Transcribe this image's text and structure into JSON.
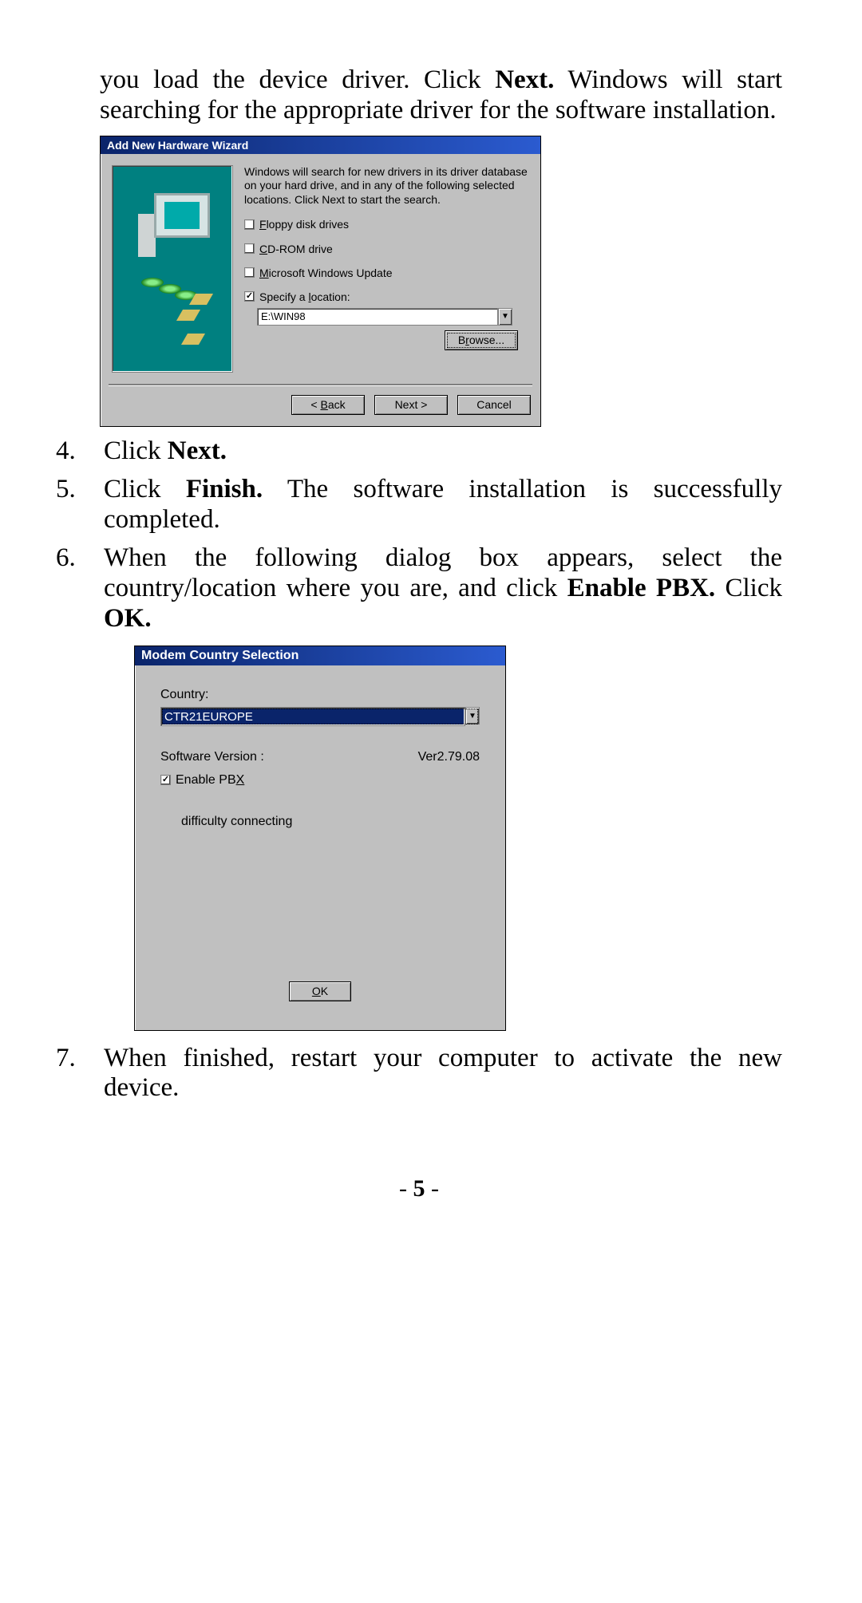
{
  "para1": {
    "pre": "you load the device driver. Click ",
    "bold1": "Next.",
    "post": " Windows will start searching for the appropriate driver for the software installation."
  },
  "wizard": {
    "title": "Add New Hardware Wizard",
    "intro": "Windows will search for new drivers in its driver database on your hard drive, and in any of the following selected locations. Click Next to start the search.",
    "floppy_u": "F",
    "floppy_rest": "loppy disk drives",
    "cdrom_u": "C",
    "cdrom_rest": "D-ROM drive",
    "msupd_u": "M",
    "msupd_rest": "icrosoft Windows Update",
    "specify_pre": "Specify a ",
    "specify_u": "l",
    "specify_post": "ocation:",
    "location_value": "E:\\WIN98",
    "browse_pre": "B",
    "browse_u": "r",
    "browse_post": "owse...",
    "back_pre": "< ",
    "back_u": "B",
    "back_post": "ack",
    "next": "Next >",
    "cancel": "Cancel"
  },
  "list": {
    "n4": "4.",
    "i4_pre": "Click ",
    "i4_bold": "Next.",
    "n5": "5.",
    "i5_pre": "Click ",
    "i5_bold": "Finish.",
    "i5_post": " The software installation is successfully completed.",
    "n6": "6.",
    "i6_pre": "When the following dialog box appears, select the country/location where you are, and click ",
    "i6_bold1": "Enable PBX.",
    "i6_mid": "  Click ",
    "i6_bold2": "OK.",
    "n7": "7.",
    "i7": "When finished, restart your computer to activate the new device."
  },
  "modem": {
    "title": "Modem Country Selection",
    "country_label": "Country:",
    "country_value": "CTR21EUROPE",
    "sv_label": "Software Version :",
    "sv_value": "Ver2.79.08",
    "enable_pre": "Enable PB",
    "enable_u": "X",
    "difficulty": "difficulty connecting",
    "ok_u": "O",
    "ok_post": "K"
  },
  "page": {
    "num_pre": "- ",
    "num": "5",
    "num_post": " -"
  }
}
